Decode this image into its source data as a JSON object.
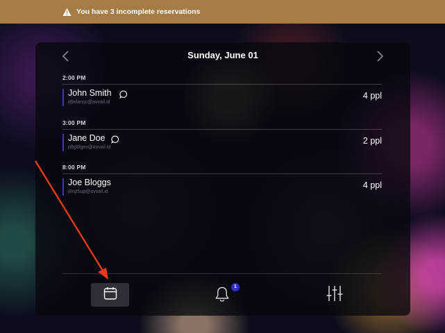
{
  "banner": {
    "icon": "warning-triangle-icon",
    "text": "You have 3 incomplete reservations",
    "color": "#a57c45"
  },
  "calendar": {
    "date_title": "Sunday, June 01",
    "prev_icon": "chevron-left-icon",
    "next_icon": "chevron-right-icon",
    "slots": [
      {
        "time": "2:00 PM",
        "reservation": {
          "name": "John Smith",
          "email": "d9xfansc@avvail.id",
          "party": "4 ppl",
          "has_note": true
        }
      },
      {
        "time": "3:00 PM",
        "reservation": {
          "name": "Jane Doe",
          "email": "p9g8fgex@avvail.id",
          "party": "2 ppl",
          "has_note": true
        }
      },
      {
        "time": "8:00 PM",
        "reservation": {
          "name": "Joe Bloggs",
          "email": "j8rqt5up@avvail.id",
          "party": "4 ppl",
          "has_note": false
        }
      }
    ]
  },
  "tabbar": {
    "tabs": [
      {
        "id": "calendar",
        "icon": "calendar-icon",
        "active": true
      },
      {
        "id": "notifications",
        "icon": "bell-icon",
        "badge": "1"
      },
      {
        "id": "settings",
        "icon": "sliders-icon"
      }
    ],
    "badge_color": "#2f2ec7"
  },
  "annotation": {
    "arrow_color": "#e8391d"
  }
}
